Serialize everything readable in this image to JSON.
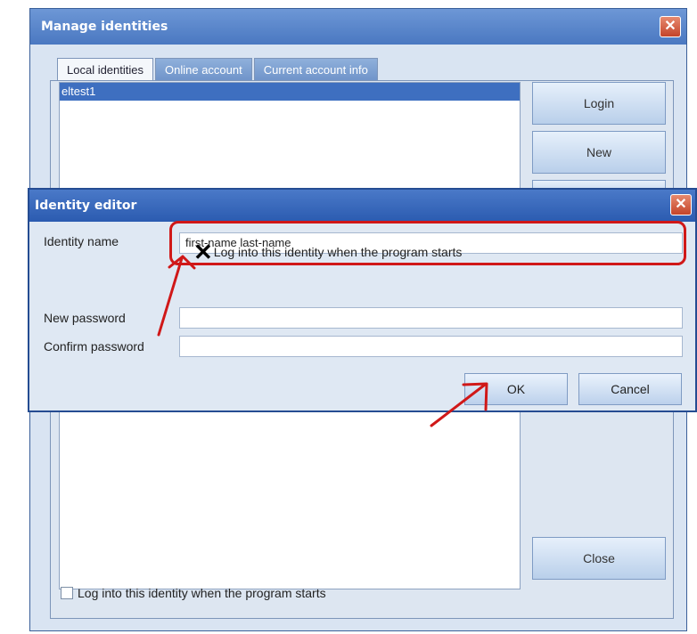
{
  "manage_window": {
    "title": "Manage identities",
    "close_glyph": "✕",
    "tabs": [
      {
        "label": "Local identities"
      },
      {
        "label": "Online account"
      },
      {
        "label": "Current account info"
      }
    ],
    "identities": [
      "eltest1"
    ],
    "buttons": {
      "login": "Login",
      "new": "New",
      "close": "Close"
    },
    "autologin_label": "Log into this identity when the program starts"
  },
  "editor_window": {
    "title": "Identity editor",
    "close_glyph": "✕",
    "identity_name_label": "Identity name",
    "identity_name_value": "first-name last-name",
    "autologin_label": "Log into this identity when the program starts",
    "autologin_checked_glyph": "✕",
    "new_password_label": "New password",
    "new_password_value": "",
    "confirm_password_label": "Confirm password",
    "confirm_password_value": "",
    "ok_label": "OK",
    "cancel_label": "Cancel"
  },
  "annotation_color": "#d01818",
  "icons": [
    "close-icon",
    "checkbox-icon",
    "x-mark-icon",
    "arrow-annotation"
  ]
}
